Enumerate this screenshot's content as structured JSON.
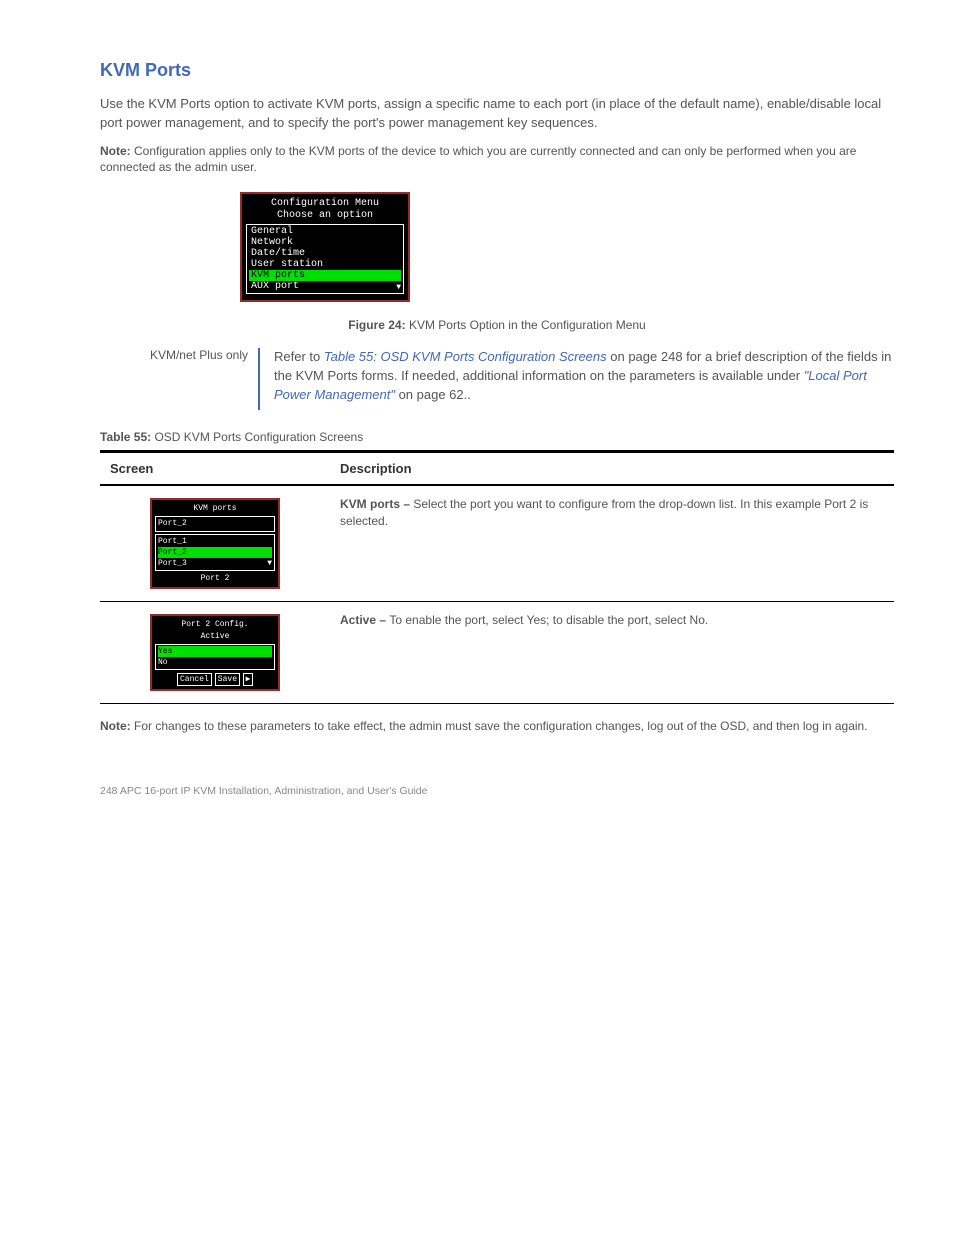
{
  "heading": "KVM Ports",
  "intro": "Use the KVM Ports option to activate KVM ports, assign a specific name to each port (in place of the default name), enable/disable local port power management, and to specify the port's power management key sequences.",
  "note1_label": "Note:",
  "note1_text": " Configuration applies only to the KVM ports of the device to which you are currently connected and can only be performed when you are connected as the admin user.",
  "menu1": {
    "title_line1": "Configuration Menu",
    "title_line2": "Choose an option",
    "items": [
      "General",
      "Network",
      "Date/time",
      "User station",
      "KVM ports",
      "AUX port"
    ],
    "selected_index": 4
  },
  "figure_caption_prefix": "Figure 24: ",
  "figure_caption": "KVM Ports Option in the Configuration Menu",
  "two_col": {
    "left_brand": "KVM/net Plus only",
    "right_prefix": "Refer to ",
    "right_link": "Table 55: OSD KVM Ports Configuration Screens",
    "right_page": " on page 248",
    "right_rest": " for a brief description of the fields in the KVM Ports forms. If needed, additional information on the parameters is available under ",
    "right_link2": "\"Local Port Power Management\"",
    "right_page2": " on page 62."
  },
  "table_caption_prefix": "Table 55: ",
  "table_caption": "OSD KVM Ports Configuration Screens",
  "table_headers": [
    "Screen",
    "Description"
  ],
  "row1": {
    "mini": {
      "title": "KVM ports",
      "box_value": "Port_2",
      "list": [
        "Port_1",
        "Port_2",
        "Port_3"
      ],
      "sel": 1,
      "footer": "Port 2"
    },
    "desc_prefix": "KVM ports – ",
    "desc": "Select the port you want to configure from the drop-down list. In this example Port 2 is selected."
  },
  "row2": {
    "mini": {
      "title_line1": "Port 2 Config.",
      "title_line2": "Active",
      "list": [
        "Yes",
        "No"
      ],
      "sel": 0,
      "buttons": [
        "Cancel",
        "Save"
      ]
    },
    "desc_prefix": "Active – ",
    "desc": "To enable the port, select Yes; to disable the port, select No."
  },
  "foot_note_label": "Note:",
  "foot_note": " For changes to these parameters to take effect, the admin must save the configuration changes, log out of the OSD, and then log in again.",
  "footer_left": "248 APC 16-port IP KVM Installation, Administration, and User's Guide",
  "footer_right": ""
}
